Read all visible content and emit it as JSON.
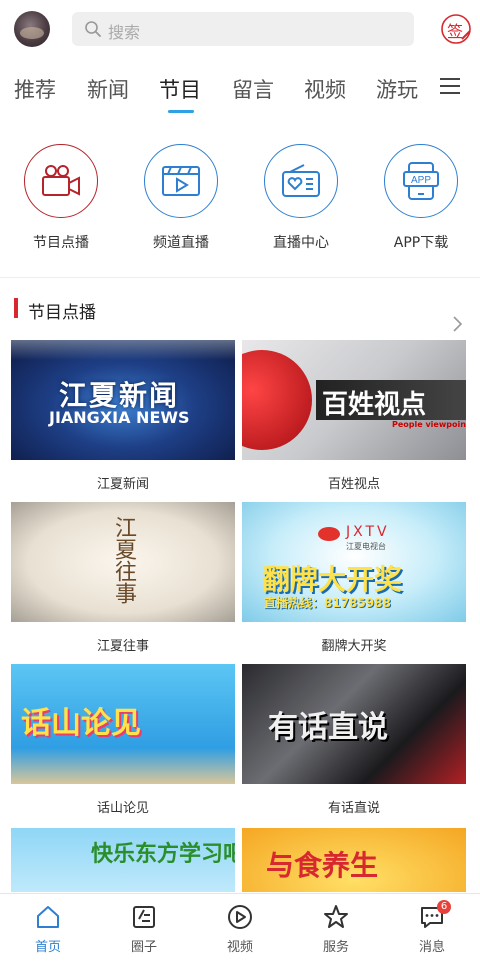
{
  "header": {
    "search_placeholder": "搜索",
    "sign_label": "签"
  },
  "tabs": [
    {
      "label": "推荐"
    },
    {
      "label": "新闻"
    },
    {
      "label": "节目",
      "active": true
    },
    {
      "label": "留言"
    },
    {
      "label": "视频"
    },
    {
      "label": "游玩"
    }
  ],
  "quick": [
    {
      "label": "节目点播",
      "icon": "camcorder-icon",
      "color": "#b5242b"
    },
    {
      "label": "频道直播",
      "icon": "play-video-icon",
      "color": "#2f7fd1"
    },
    {
      "label": "直播中心",
      "icon": "radio-icon",
      "color": "#2f7fd1"
    },
    {
      "label": "APP下载",
      "icon": "app-phone-icon",
      "color": "#2f7fd1"
    }
  ],
  "section": {
    "title": "节目点播"
  },
  "programs": [
    {
      "caption": "江夏新闻",
      "thumb_title": "江夏新闻",
      "thumb_sub": "JIANGXIA NEWS"
    },
    {
      "caption": "百姓视点",
      "thumb_title": "百姓视点",
      "thumb_sub": "People viewpoint"
    },
    {
      "caption": "江夏往事",
      "thumb_title": "江夏往事"
    },
    {
      "caption": "翻牌大开奖",
      "thumb_title": "翻牌大开奖",
      "thumb_brand": "JXTV",
      "thumb_brand_sub": "江夏电视台",
      "thumb_hotline": "直播热线：81785988"
    },
    {
      "caption": "话山论见",
      "thumb_title": "话山论见"
    },
    {
      "caption": "有话直说",
      "thumb_title": "有话直说"
    },
    {
      "caption": "",
      "thumb_title": "快乐东方学习吧"
    },
    {
      "caption": "",
      "thumb_title": "与食养生"
    }
  ],
  "bottom_nav": [
    {
      "label": "首页",
      "icon": "home-icon",
      "active": true
    },
    {
      "label": "圈子",
      "icon": "circle-icon"
    },
    {
      "label": "视频",
      "icon": "play-icon"
    },
    {
      "label": "服务",
      "icon": "star-icon"
    },
    {
      "label": "消息",
      "icon": "message-icon",
      "badge": "6"
    }
  ],
  "colors": {
    "accent": "#2f7fd1",
    "tab_indicator": "#2ea0e6",
    "section_bar": "#d8282f",
    "badge": "#e8413b"
  }
}
